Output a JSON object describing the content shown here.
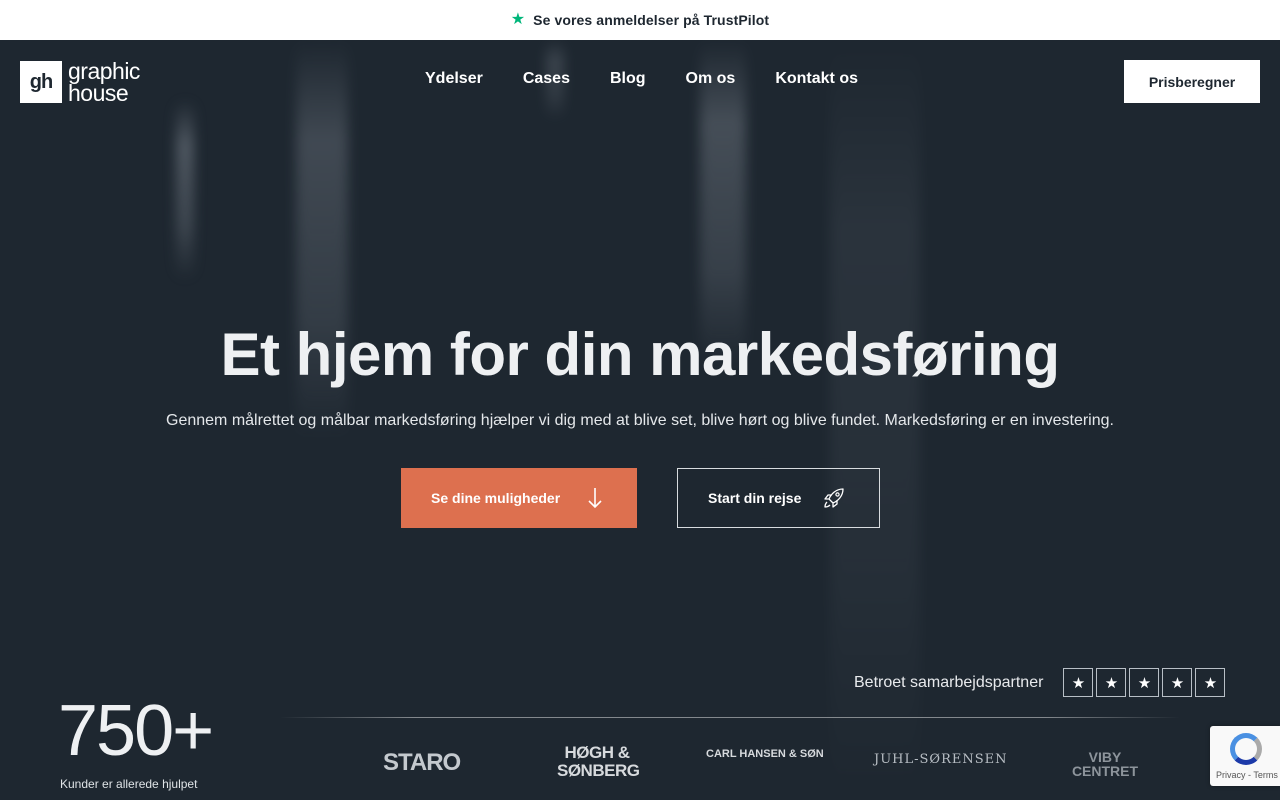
{
  "topbar": {
    "icon": "star-icon",
    "text": "Se vores anmeldelser på TrustPilot",
    "icon_color": "#00b67a"
  },
  "header": {
    "logo": {
      "mark": "gh",
      "line1": "graphic",
      "line2": "house"
    },
    "nav": [
      "Ydelser",
      "Cases",
      "Blog",
      "Om os",
      "Kontakt os"
    ],
    "cta_label": "Prisberegner"
  },
  "hero": {
    "title": "Et hjem for din markedsføring",
    "subtitle": "Gennem målrettet og målbar markedsføring hjælper vi dig med at blive set, blive hørt og blive fundet. Markedsføring er en investering.",
    "primary_button": {
      "label": "Se dine muligheder",
      "icon": "arrow-down-icon",
      "color": "#dd704f"
    },
    "secondary_button": {
      "label": "Start din rejse",
      "icon": "rocket-icon"
    }
  },
  "stats": {
    "number": "750+",
    "label": "Kunder er allerede hjulpet"
  },
  "trust": {
    "label": "Betroet samarbejdspartner",
    "stars": 5
  },
  "partners": [
    "STARO",
    "HØGH & SØNBERG",
    "CARL HANSEN & SØN",
    "JUHL-SØRENSEN",
    "VIBY CENTRET"
  ],
  "recaptcha": {
    "terms": "Privacy - Terms"
  },
  "colors": {
    "background": "#1e2730",
    "accent": "#dd704f",
    "trustpilot": "#00b67a"
  }
}
